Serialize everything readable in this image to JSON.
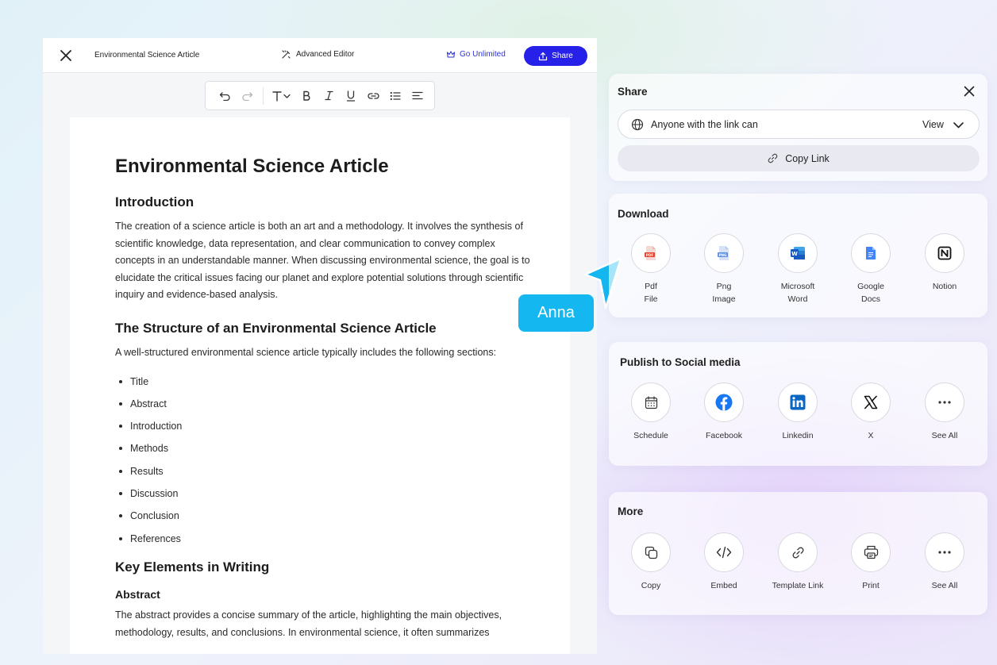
{
  "topbar": {
    "doc_title": "Environmental Science Article",
    "advanced_editor": "Advanced Editor",
    "go_unlimited": "Go Unlimited",
    "share": "Share"
  },
  "toolbar": {
    "tools": [
      "undo-icon",
      "redo-icon",
      "text-style-icon",
      "bold-icon",
      "italic-icon",
      "underline-icon",
      "link-icon",
      "bullet-list-icon",
      "align-left-icon"
    ]
  },
  "document": {
    "title": "Environmental Science Article",
    "intro_heading": "Introduction",
    "intro_text": "The creation of a science article is both an art and a methodology. It involves the synthesis of scientific knowledge, data representation, and clear communication to convey complex concepts in an understandable manner. When discussing environmental science, the goal is to elucidate the critical issues facing our planet and explore potential solutions through scientific inquiry and evidence-based analysis.",
    "structure_heading": "The Structure of an Environmental Science Article",
    "structure_text": "A well-structured environmental science article typically includes the following sections:",
    "sections": [
      "Title",
      "Abstract",
      "Introduction",
      "Methods",
      "Results",
      "Discussion",
      "Conclusion",
      "References"
    ],
    "key_heading": "Key Elements in Writing",
    "abstract_heading": "Abstract",
    "abstract_text": "The abstract provides a concise summary of the article, highlighting the main objectives, methodology, results, and conclusions. In environmental science, it often summarizes"
  },
  "cursor": {
    "user_name": "Anna",
    "color": "#14b7ef"
  },
  "share_panel": {
    "title": "Share",
    "link_access": "Anyone with the link can",
    "permission": "View",
    "copy_link": "Copy Link"
  },
  "download_panel": {
    "title": "Download",
    "items": [
      {
        "label": "Pdf\nFile",
        "icon": "pdf-file-icon"
      },
      {
        "label": "Png\nImage",
        "icon": "png-image-icon"
      },
      {
        "label": "Microsoft\nWord",
        "icon": "microsoft-word-icon"
      },
      {
        "label": "Google\nDocs",
        "icon": "google-docs-icon"
      },
      {
        "label": "Notion",
        "icon": "notion-icon"
      }
    ]
  },
  "social_panel": {
    "title": "Publish to Social media",
    "items": [
      {
        "label": "Schedule",
        "icon": "calendar-icon"
      },
      {
        "label": "Facebook",
        "icon": "facebook-icon"
      },
      {
        "label": "Linkedin",
        "icon": "linkedin-icon"
      },
      {
        "label": "X",
        "icon": "x-icon"
      },
      {
        "label": "See All",
        "icon": "more-dots-icon"
      }
    ]
  },
  "more_panel": {
    "title": "More",
    "items": [
      {
        "label": "Copy",
        "icon": "copy-icon"
      },
      {
        "label": "Embed",
        "icon": "embed-code-icon"
      },
      {
        "label": "Template Link",
        "icon": "template-link-icon"
      },
      {
        "label": "Print",
        "icon": "printer-icon"
      },
      {
        "label": "See All",
        "icon": "more-dots-icon"
      }
    ]
  },
  "colors": {
    "primary": "#2620e8",
    "facebook": "#1877f2",
    "linkedin": "#0a66c2",
    "word": "#185abd",
    "google_docs": "#4285f4",
    "pdf": "#e5452f"
  }
}
